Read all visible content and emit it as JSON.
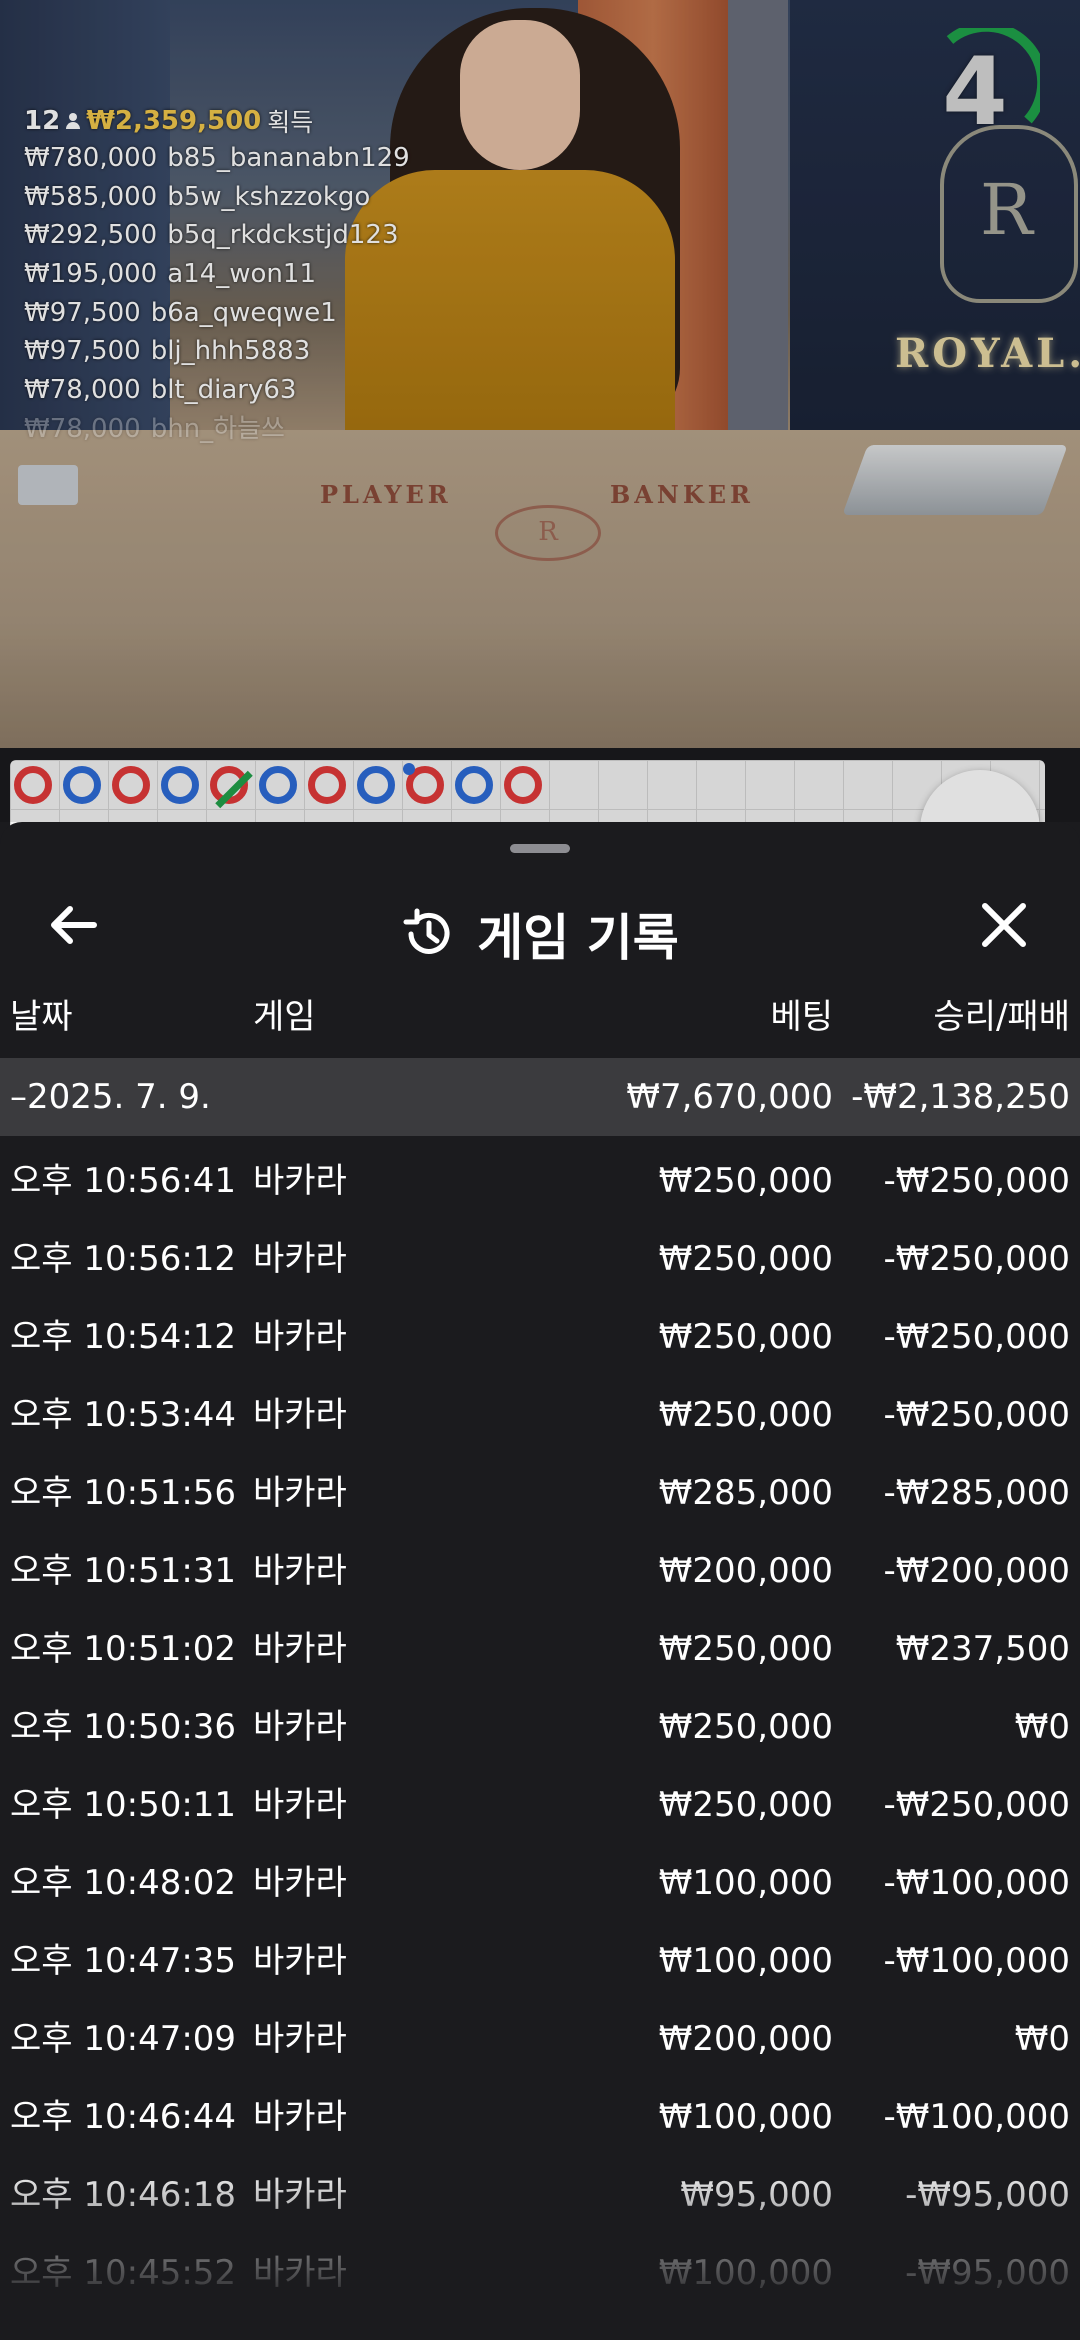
{
  "winners": {
    "count": "12",
    "total": "₩2,359,500",
    "label": "획득",
    "list": [
      {
        "amount": "₩780,000",
        "user": "b85_bananabn129"
      },
      {
        "amount": "₩585,000",
        "user": "b5w_kshzzokgo"
      },
      {
        "amount": "₩292,500",
        "user": "b5q_rkdckstjd123"
      },
      {
        "amount": "₩195,000",
        "user": "a14_won11"
      },
      {
        "amount": "₩97,500",
        "user": "b6a_qweqwe1"
      },
      {
        "amount": "₩97,500",
        "user": "blj_hhh5883"
      },
      {
        "amount": "₩78,000",
        "user": "blt_diary63"
      },
      {
        "amount": "₩78,000",
        "user": "bhn_하늘쓰"
      }
    ]
  },
  "countdown": "4",
  "table": {
    "player_label": "PLAYER",
    "banker_label": "BANKER",
    "brand": "ROYAL.",
    "logo_letter": "R"
  },
  "road_beads": [
    "r",
    "b",
    "r",
    "b",
    "r-slash",
    "b",
    "r",
    "b",
    "r-tie",
    "b",
    "r"
  ],
  "sheet": {
    "title": "게임 기록",
    "columns": {
      "date": "날짜",
      "game": "게임",
      "bet": "베팅",
      "result": "승리/패배"
    },
    "date_group": {
      "date": "–2025. 7. 9.",
      "bet": "₩7,670,000",
      "result": "-₩2,138,250"
    },
    "rows": [
      {
        "time": "오후 10:56:41",
        "game": "바카라",
        "bet": "₩250,000",
        "result": "-₩250,000"
      },
      {
        "time": "오후 10:56:12",
        "game": "바카라",
        "bet": "₩250,000",
        "result": "-₩250,000"
      },
      {
        "time": "오후 10:54:12",
        "game": "바카라",
        "bet": "₩250,000",
        "result": "-₩250,000"
      },
      {
        "time": "오후 10:53:44",
        "game": "바카라",
        "bet": "₩250,000",
        "result": "-₩250,000"
      },
      {
        "time": "오후 10:51:56",
        "game": "바카라",
        "bet": "₩285,000",
        "result": "-₩285,000"
      },
      {
        "time": "오후 10:51:31",
        "game": "바카라",
        "bet": "₩200,000",
        "result": "-₩200,000"
      },
      {
        "time": "오후 10:51:02",
        "game": "바카라",
        "bet": "₩250,000",
        "result": "₩237,500"
      },
      {
        "time": "오후 10:50:36",
        "game": "바카라",
        "bet": "₩250,000",
        "result": "₩0"
      },
      {
        "time": "오후 10:50:11",
        "game": "바카라",
        "bet": "₩250,000",
        "result": "-₩250,000"
      },
      {
        "time": "오후 10:48:02",
        "game": "바카라",
        "bet": "₩100,000",
        "result": "-₩100,000"
      },
      {
        "time": "오후 10:47:35",
        "game": "바카라",
        "bet": "₩100,000",
        "result": "-₩100,000"
      },
      {
        "time": "오후 10:47:09",
        "game": "바카라",
        "bet": "₩200,000",
        "result": "₩0"
      },
      {
        "time": "오후 10:46:44",
        "game": "바카라",
        "bet": "₩100,000",
        "result": "-₩100,000"
      },
      {
        "time": "오후 10:46:18",
        "game": "바카라",
        "bet": "₩95,000",
        "result": "-₩95,000"
      },
      {
        "time": "오후 10:45:52",
        "game": "바카라",
        "bet": "₩100,000",
        "result": "-₩95,000"
      }
    ]
  },
  "icons": {
    "back": "arrow-left-icon",
    "history": "history-icon",
    "close": "close-icon",
    "person": "person-icon"
  },
  "colors": {
    "gold": "#f3c94c",
    "player_blue": "#2d6bd8",
    "banker_red": "#e23a3a",
    "tie_green": "#22a14a",
    "sheet_bg": "#1b1b1e"
  }
}
